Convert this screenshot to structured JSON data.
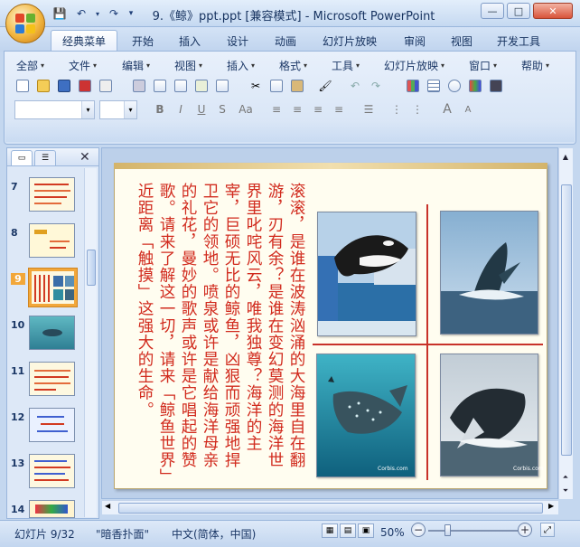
{
  "window": {
    "title": "9.《鲸》ppt.ppt [兼容模式] - Microsoft PowerPoint",
    "minimize_glyph": "—",
    "maximize_glyph": "□",
    "close_glyph": "✕"
  },
  "qat": {
    "save": "💾",
    "undo": "↶",
    "undo_caret": "▾",
    "redo": "↷",
    "customize": "▾"
  },
  "ribbon_tabs": [
    "经典菜单",
    "开始",
    "插入",
    "设计",
    "动画",
    "幻灯片放映",
    "审阅",
    "视图",
    "开发工具"
  ],
  "classic_menus": [
    "全部",
    "文件",
    "编辑",
    "视图",
    "插入",
    "格式",
    "工具",
    "幻灯片放映",
    "窗口",
    "帮助"
  ],
  "formatting": {
    "bold": "B",
    "italic": "I",
    "underline": "U",
    "strike": "S",
    "case": "Aa",
    "grow": "A",
    "shrink": "A"
  },
  "thumbnails": [
    {
      "num": "7"
    },
    {
      "num": "8"
    },
    {
      "num": "9"
    },
    {
      "num": "10"
    },
    {
      "num": "11"
    },
    {
      "num": "12"
    },
    {
      "num": "13"
    },
    {
      "num": "14"
    }
  ],
  "slide": {
    "poem": "滚滚，是谁在波涛汹涌的大海里自在翻游，刃有余？是谁在变幻莫测的海洋世界里叱咤风云，唯我独尊？海洋的主宰，巨硕无比的鲸鱼，凶狠而顽强地捍卫它的领地。喷泉或许是献给海洋母亲的礼花，曼妙的歌声或许是它唱起的赞歌。请来了解这一切，请来「鲸鱼世界」近距离「触摸」这强大的生命。",
    "photos": [
      {
        "caption": ""
      },
      {
        "caption": ""
      },
      {
        "caption": "Corbis.com"
      },
      {
        "caption": "Corbis.com"
      }
    ]
  },
  "status": {
    "slide_info": "幻灯片 9/32",
    "theme": "\"暗香扑面\"",
    "language": "中文(简体，中国)",
    "zoom": "50%",
    "zoom_out": "−",
    "zoom_in": "+"
  },
  "colors": {
    "accent": "#d12b1e",
    "frame": "#9ab6dc"
  }
}
